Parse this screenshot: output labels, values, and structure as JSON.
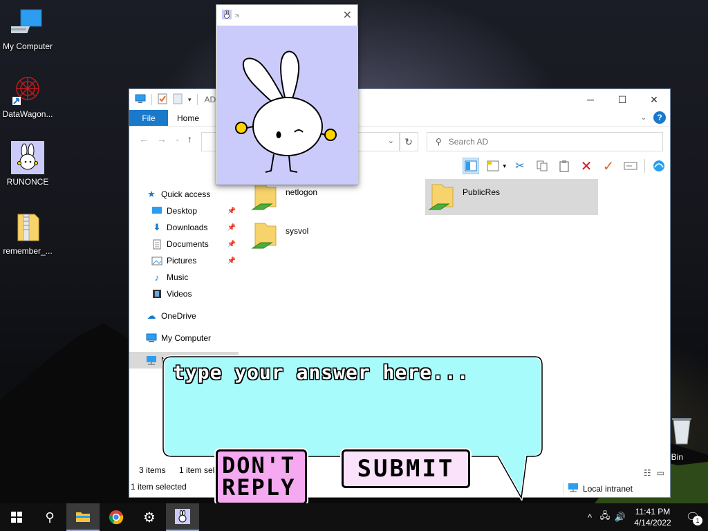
{
  "desktop": {
    "icons": [
      {
        "label": "My Computer",
        "icon": "computer-icon"
      },
      {
        "label": "DataWagon...",
        "icon": "datawagon-icon"
      },
      {
        "label": "RUNONCE",
        "icon": "bunny-icon"
      },
      {
        "label": "remember_...",
        "icon": "zip-folder-icon"
      }
    ],
    "recycle_bin_label": "cle Bin"
  },
  "explorer": {
    "title": "AD",
    "tabs": {
      "file": "File",
      "home": "Home"
    },
    "search_placeholder": "Search AD",
    "nav": {
      "quick_access": "Quick access",
      "items": [
        {
          "label": "Desktop",
          "icon": "desktop-icon",
          "pinned": true
        },
        {
          "label": "Downloads",
          "icon": "download-arrow-icon",
          "pinned": true
        },
        {
          "label": "Documents",
          "icon": "document-icon",
          "pinned": true
        },
        {
          "label": "Pictures",
          "icon": "pictures-icon",
          "pinned": true
        },
        {
          "label": "Music",
          "icon": "music-note-icon",
          "pinned": false
        },
        {
          "label": "Videos",
          "icon": "film-icon",
          "pinned": false
        }
      ],
      "onedrive": "OneDrive",
      "my_computer": "My Computer",
      "network": "N"
    },
    "files": [
      {
        "name": "netlogon",
        "icon": "share-folder-icon"
      },
      {
        "name": "sysvol",
        "icon": "share-folder-icon"
      },
      {
        "name": "PublicRes",
        "icon": "share-folder-icon"
      }
    ],
    "status": {
      "item_count": "3 items",
      "selected_partial": "1 item sel",
      "selected": "1 item selected",
      "zone": "Local intranet"
    }
  },
  "popup": {
    "title": ":s",
    "close": "✕"
  },
  "bubble": {
    "placeholder": "type your answer here..."
  },
  "buttons": {
    "dont_reply_line1": "DON'T",
    "dont_reply_line2": "REPLY",
    "submit": "SUBMIT"
  },
  "taskbar": {
    "time": "11:41 PM",
    "date": "4/14/2022",
    "notification_count": "1"
  },
  "colors": {
    "accent": "#1979ca",
    "bubble": "#a8fbfb",
    "popup_bg": "#cbcbfb",
    "dont_reply": "#f5a9f0",
    "submit": "#fae2fb"
  }
}
